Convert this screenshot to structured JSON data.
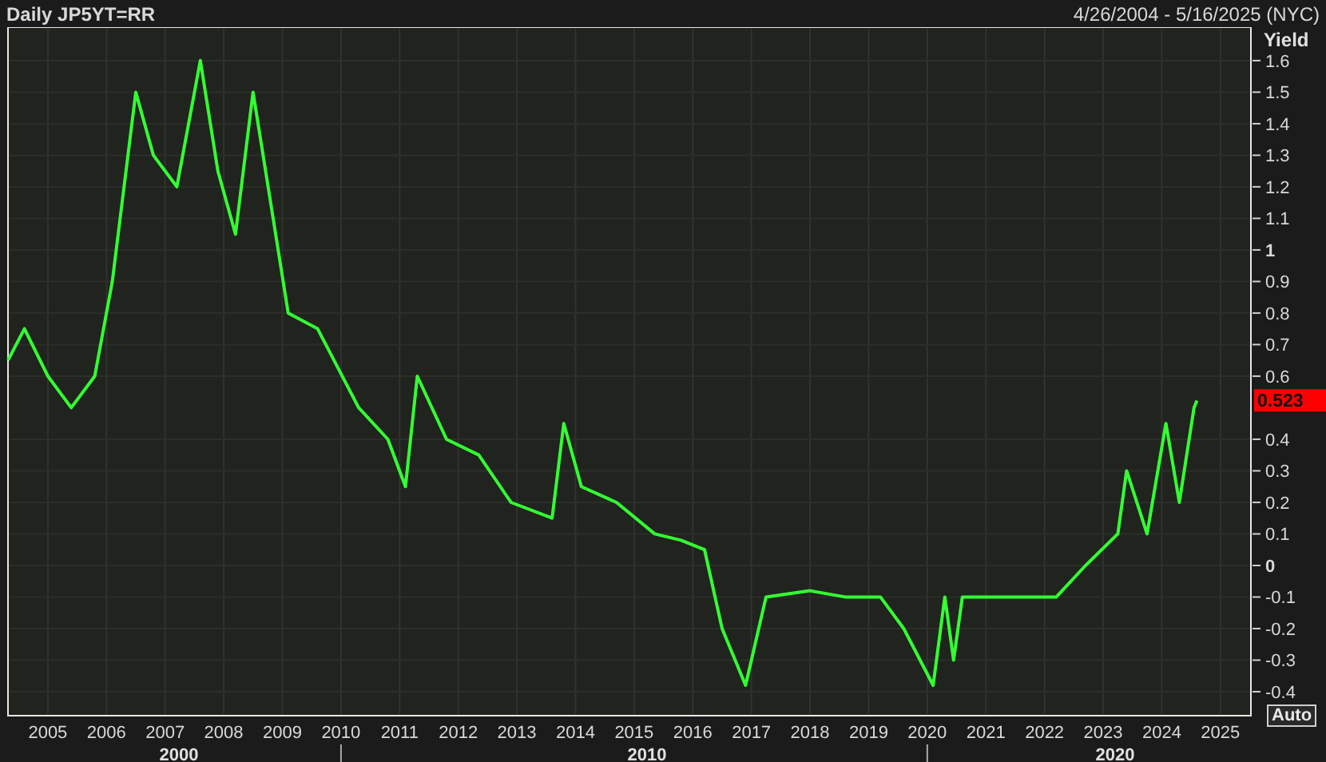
{
  "header": {
    "title": "Daily JP5YT=RR",
    "range": "4/26/2004 - 5/16/2025 (NYC)"
  },
  "chart": {
    "auto_button": "Auto",
    "last_price": "0.523",
    "decades": [
      "2000",
      "2010",
      "2020"
    ],
    "chart_data": {
      "type": "line",
      "ylabel": "Yield",
      "x": [
        2004.32,
        2004.6,
        2005.0,
        2005.4,
        2005.8,
        2006.1,
        2006.5,
        2006.8,
        2007.2,
        2007.6,
        2007.9,
        2008.2,
        2008.5,
        2008.8,
        2009.1,
        2009.6,
        2010.3,
        2010.8,
        2011.1,
        2011.3,
        2011.8,
        2012.35,
        2012.9,
        2013.6,
        2013.8,
        2014.1,
        2014.7,
        2015.35,
        2015.8,
        2016.2,
        2016.5,
        2016.9,
        2017.25,
        2018.0,
        2018.6,
        2019.2,
        2019.6,
        2020.1,
        2020.3,
        2020.45,
        2020.6,
        2021.35,
        2022.2,
        2022.7,
        2023.25,
        2023.4,
        2023.75,
        2024.07,
        2024.3,
        2024.55,
        2024.6
      ],
      "xlim": [
        2004.32,
        2025.52
      ],
      "ylim": [
        -0.476,
        1.706
      ],
      "grid": true,
      "series": [
        {
          "color": "#33ff33",
          "values": [
            0.65,
            0.75,
            0.6,
            0.5,
            0.6,
            0.9,
            1.5,
            1.3,
            1.2,
            1.6,
            1.25,
            1.05,
            1.5,
            1.15,
            0.8,
            0.75,
            0.5,
            0.4,
            0.25,
            0.6,
            0.4,
            0.35,
            0.2,
            0.15,
            0.45,
            0.25,
            0.2,
            0.1,
            0.08,
            0.05,
            -0.2,
            -0.38,
            -0.1,
            -0.08,
            -0.1,
            -0.1,
            -0.2,
            -0.38,
            -0.1,
            -0.3,
            -0.1,
            -0.1,
            -0.1,
            0.0,
            0.1,
            0.3,
            0.1,
            0.45,
            0.2,
            0.5,
            0.523
          ]
        }
      ],
      "xticks": [
        2005,
        2006,
        2007,
        2008,
        2009,
        2010,
        2011,
        2012,
        2013,
        2014,
        2015,
        2016,
        2017,
        2018,
        2019,
        2020,
        2021,
        2022,
        2023,
        2024,
        2025
      ],
      "yticks": [
        1.6,
        1.5,
        1.4,
        1.3,
        1.2,
        1.1,
        1,
        0.9,
        0.8,
        0.7,
        0.6,
        0.4,
        0.3,
        0.2,
        0.1,
        0,
        -0.1,
        -0.2,
        -0.3,
        -0.4
      ]
    }
  }
}
